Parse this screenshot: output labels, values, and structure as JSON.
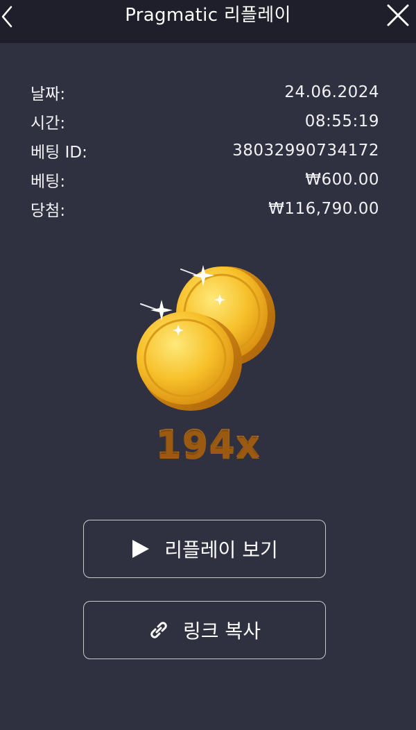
{
  "header": {
    "title": "Pragmatic 리플레이",
    "back_icon": "chevron-left-icon",
    "close_icon": "close-icon"
  },
  "info": [
    {
      "label": "날짜:",
      "value": "24.06.2024"
    },
    {
      "label": "시간:",
      "value": "08:55:19"
    },
    {
      "label": "베팅 ID:",
      "value": "38032990734172"
    },
    {
      "label": "베팅:",
      "value": "₩600.00"
    },
    {
      "label": "당첨:",
      "value": "₩116,790.00"
    }
  ],
  "result": {
    "multiplier": "194x",
    "image_icon": "gold-coins-icon"
  },
  "buttons": {
    "replay_label": "리플레이 보기",
    "replay_icon": "play-icon",
    "copy_link_label": "링크 복사",
    "copy_link_icon": "link-icon"
  },
  "colors": {
    "background": "#2f3040",
    "header": "#1e1f2b",
    "gold": "#f2b41f"
  }
}
